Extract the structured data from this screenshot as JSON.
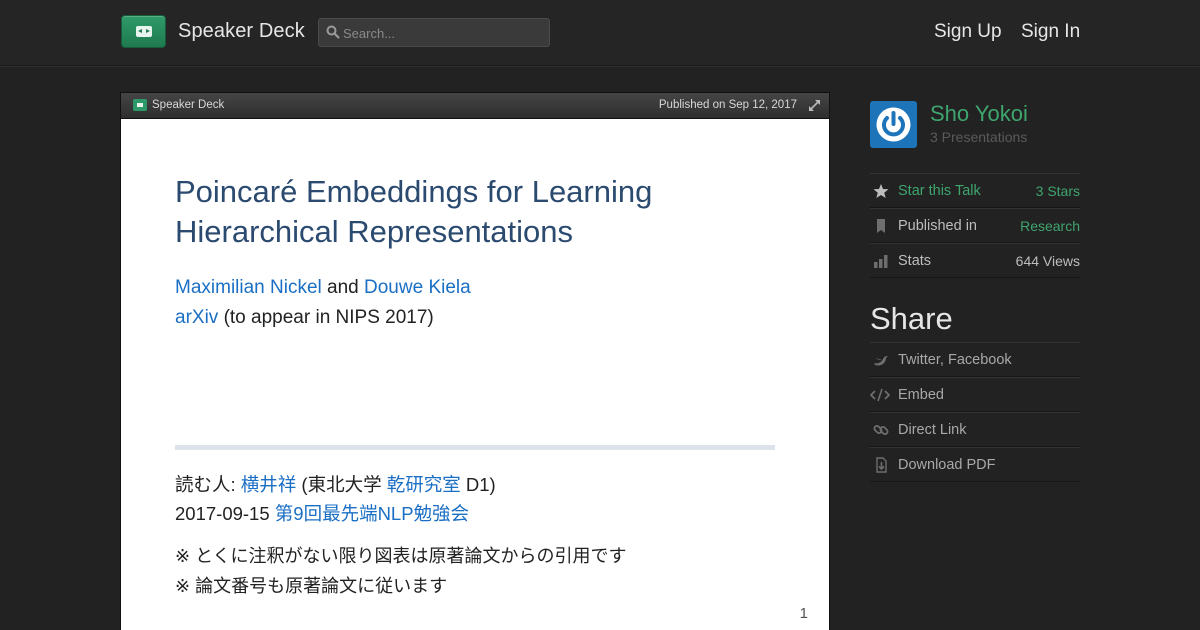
{
  "header": {
    "brand": "Speaker Deck",
    "search_placeholder": "Search...",
    "sign_up": "Sign Up",
    "sign_in": "Sign In"
  },
  "viewer": {
    "brand": "Speaker Deck",
    "published": "Published on Sep 12, 2017"
  },
  "slide": {
    "title_line1": "Poincaré Embeddings for Learning",
    "title_line2": "Hierarchical Representations",
    "author1": "Maximilian Nickel",
    "and": " and ",
    "author2": "Douwe Kiela",
    "venue_link": "arXiv",
    "venue_rest": " (to appear in NIPS 2017)",
    "reader_prefix": "読む人: ",
    "reader_name": "横井祥",
    "reader_mid": " (東北大学 ",
    "reader_lab": "乾研究室",
    "reader_suffix": " D1)",
    "date": "2017-09-15 ",
    "event": "第9回最先端NLP勉強会",
    "note1": "※ とくに注釈がない限り図表は原著論文からの引用です",
    "note2": "※ 論文番号も原著論文に従います",
    "page_number": "1"
  },
  "sidebar": {
    "author_name": "Sho Yokoi",
    "author_presentations": "3 Presentations",
    "star_label": "Star this Talk",
    "star_count": "3 Stars",
    "published_label": "Published in",
    "published_value": "Research",
    "stats_label": "Stats",
    "stats_value": "644 Views",
    "share_title": "Share",
    "share_items": [
      "Twitter, Facebook",
      "Embed",
      "Direct Link",
      "Download PDF"
    ]
  },
  "colors": {
    "accent_green": "#3fa56e",
    "link_blue": "#1a6fc4",
    "title_blue": "#2b4a6f",
    "avatar_blue": "#1e74b8"
  },
  "icons": [
    "speakerdeck-logo-icon",
    "search-icon",
    "expand-icon",
    "star-icon",
    "bookmark-icon",
    "bar-chart-icon",
    "bird-icon",
    "code-icon",
    "link-icon",
    "download-icon",
    "power-icon"
  ]
}
